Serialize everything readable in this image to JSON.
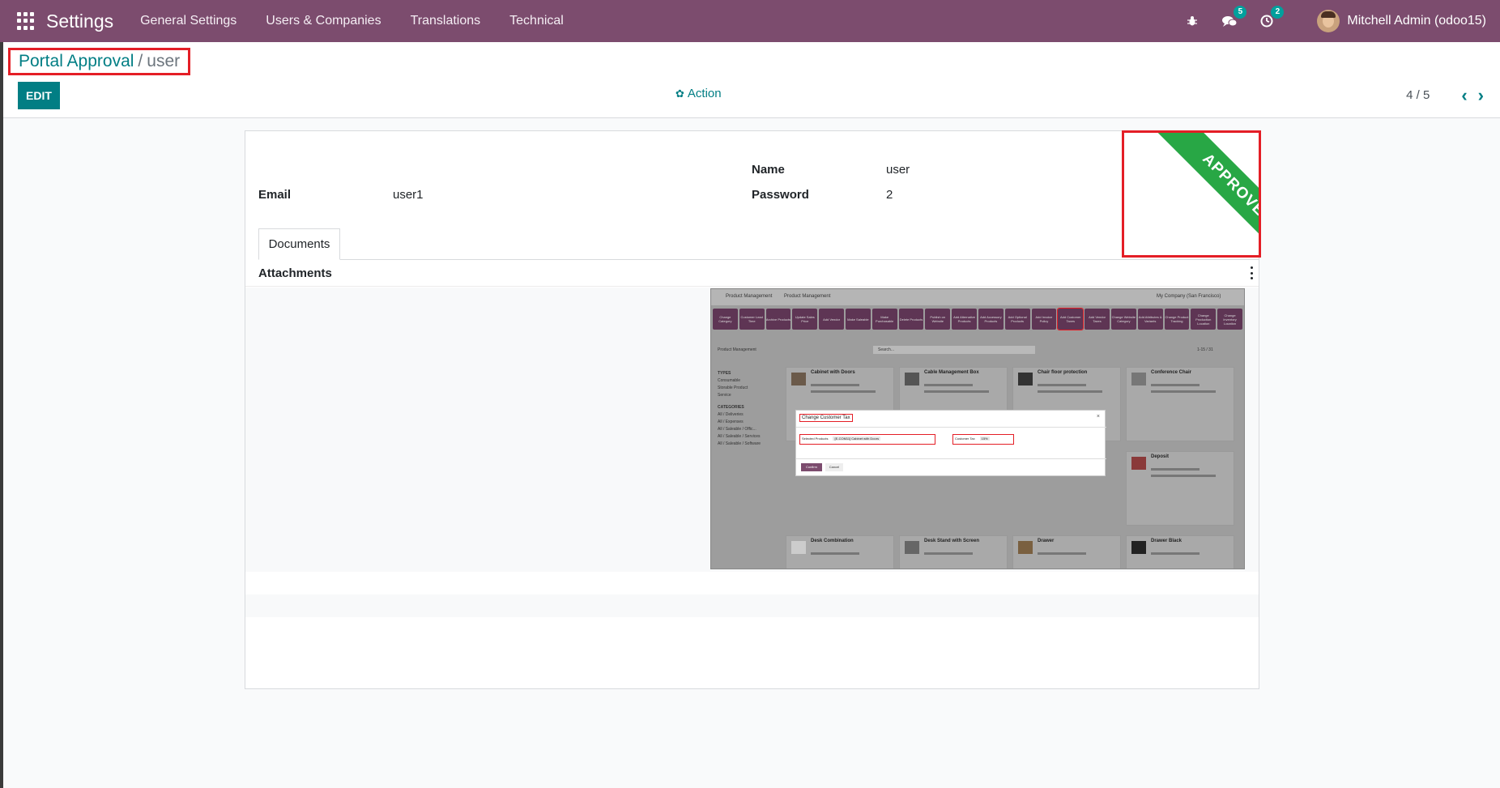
{
  "topbar": {
    "app_title": "Settings",
    "menu": [
      "General Settings",
      "Users & Companies",
      "Translations",
      "Technical"
    ],
    "icons": [
      "apps-grid-icon",
      "bug-icon",
      "chat-icon",
      "clock-icon"
    ],
    "messages_count": "5",
    "activities_count": "2",
    "user_name": "Mitchell Admin (odoo15)"
  },
  "breadcrumb": {
    "parent": "Portal Approval",
    "separator": "/",
    "current": "user"
  },
  "control": {
    "edit_label": "EDIT",
    "action_label": "Action",
    "pager_value": "4 / 5"
  },
  "form": {
    "name_label": "Name",
    "name_value": "user",
    "email_label": "Email",
    "email_value": "user1",
    "password_label": "Password",
    "password_value": "2",
    "ribbon": "APPROVED",
    "tab_documents": "Documents",
    "attachments_label": "Attachments"
  },
  "thumbnail": {
    "app_name": "Product Management",
    "menu": "Product Management",
    "company": "My Company (San Francisco)",
    "buttons": [
      "Change Category",
      "Customer Lead Time",
      "Archive Products",
      "Update Sales Price",
      "Add Vendor",
      "Make Saleable",
      "Make Purchasable",
      "Delete Products",
      "Publish on Website",
      "Add Alternative Products",
      "Add Accessory Products",
      "Add Optional Products",
      "Add Invoice Policy",
      "Add Customer Taxes",
      "Add Vendor Taxes",
      "Change Website Category",
      "Add Attributes & Variants",
      "Change Product Tracking",
      "Change Production Location",
      "Change Inventory Location"
    ],
    "bar_label": "Product Management",
    "search_placeholder": "Search...",
    "pager": "1-15 / 31",
    "side_types": "TYPES",
    "side_type_items": [
      "Consumable",
      "Storable Product",
      "Service"
    ],
    "side_categories": "CATEGORIES",
    "side_category_items": [
      "All / Deliveries",
      "All / Expenses",
      "All / Saleable / Offic...",
      "All / Saleable / Services",
      "All / Saleable / Software"
    ],
    "cards": [
      "Cabinet with Doors",
      "Cable Management Box",
      "Chair floor protection",
      "Conference Chair",
      "Deposit",
      "Desk Combination",
      "Desk Stand with Screen",
      "Drawer",
      "Drawer Black"
    ],
    "modal_title": "Change Customer Tax",
    "modal_field1": "Selected Products",
    "modal_field1_tag": "[E-COM11] Cabinet with Doors",
    "modal_field2": "Customer Tax",
    "modal_field2_tag": "15%",
    "modal_confirm": "Confirm",
    "modal_cancel": "Cancel"
  }
}
